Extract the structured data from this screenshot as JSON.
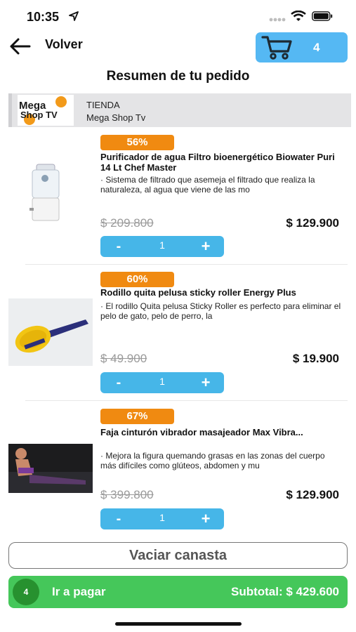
{
  "status": {
    "time": "10:35"
  },
  "nav": {
    "back_label": "Volver",
    "cart_count": "4"
  },
  "summary_title": "Resumen de tu pedido",
  "store": {
    "label": "TIENDA",
    "name": "Mega Shop Tv",
    "logo_text": "Mega Shop TV"
  },
  "products": [
    {
      "discount": "56%",
      "name": "Purificador de agua Filtro bioenergético Biowater Puri 14 Lt Chef Master",
      "desc": "· Sistema de filtrado que asemeja el filtrado que realiza la naturaleza, al agua que viene de las mo",
      "old_price": "$ 209.800",
      "price": "$ 129.900",
      "qty": "1",
      "minus": "-",
      "plus": "+"
    },
    {
      "discount": "60%",
      "name": "Rodillo quita pelusa sticky roller Energy Plus",
      "desc": "· El rodillo Quita pelusa Sticky Roller es perfecto para eliminar el pelo de gato, pelo de perro, la",
      "old_price": "$ 49.900",
      "price": "$ 19.900",
      "qty": "1",
      "minus": "-",
      "plus": "+"
    },
    {
      "discount": "67%",
      "name": "Faja cinturón vibrador masajeador Max Vibra...",
      "desc": "· Mejora la figura quemando grasas en las zonas del cuerpo más difíciles como glúteos, abdomen y mu",
      "old_price": "$ 399.800",
      "price": "$ 129.900",
      "qty": "1",
      "minus": "-",
      "plus": "+"
    }
  ],
  "actions": {
    "empty_cart": "Vaciar canasta",
    "pay_count": "4",
    "pay_label": "Ir a pagar",
    "subtotal": "Subtotal: $ 429.600"
  },
  "colors": {
    "cart_blue": "#55b8f3",
    "stepper_blue": "#46b6e8",
    "discount_orange": "#f08a11",
    "pay_green": "#45c75a"
  }
}
